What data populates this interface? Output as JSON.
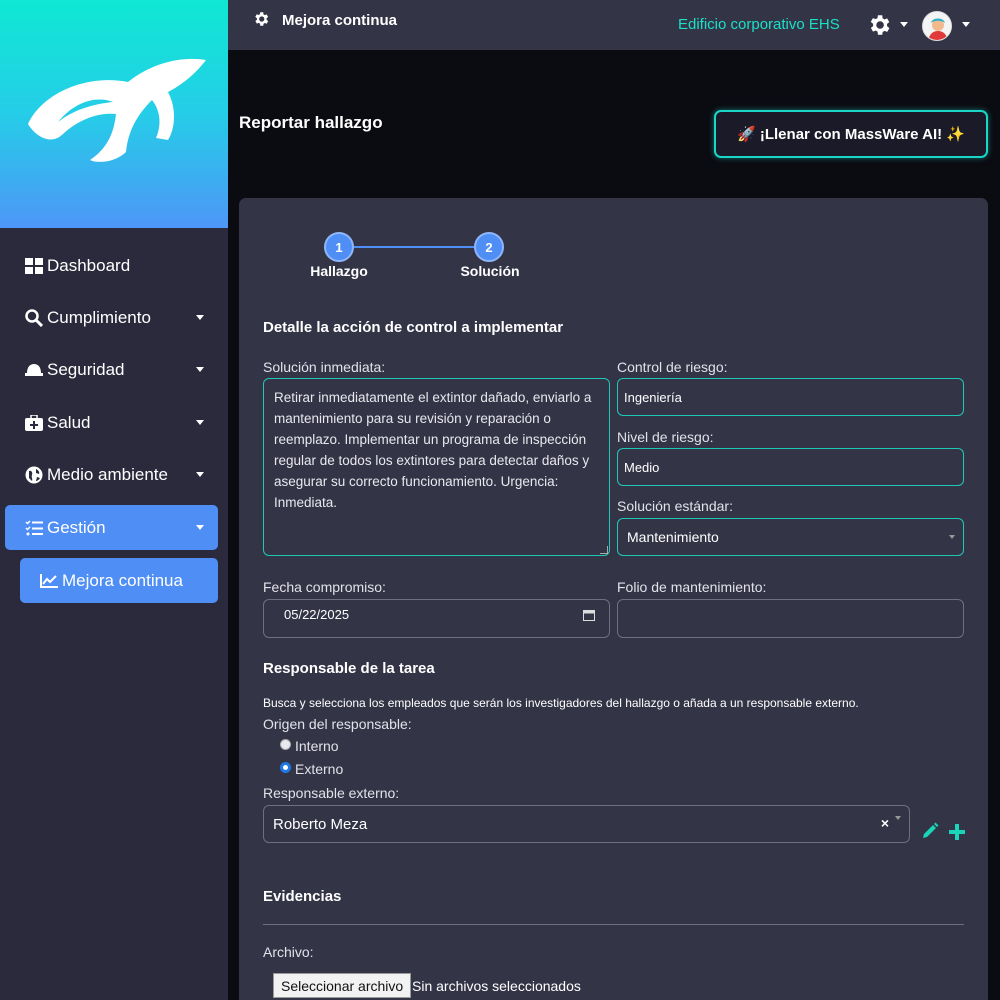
{
  "colors": {
    "accent": "#4f8ef5",
    "teal": "#19e0c8",
    "sidebar": "#2a2a3c",
    "card": "#343447"
  },
  "topbar": {
    "title": "Mejora continua",
    "building": "Edificio corporativo EHS",
    "gear_icon": "gear-icon",
    "avatar": "avatar"
  },
  "sidebar": {
    "items": [
      {
        "label": "Dashboard",
        "icon": "grid-icon"
      },
      {
        "label": "Cumplimiento",
        "icon": "search-icon"
      },
      {
        "label": "Seguridad",
        "icon": "hardhat-icon"
      },
      {
        "label": "Salud",
        "icon": "medkit-icon"
      },
      {
        "label": "Medio ambiente",
        "icon": "globe-icon"
      },
      {
        "label": "Gestión",
        "icon": "tasks-icon"
      }
    ],
    "subitem": {
      "label": "Mejora continua",
      "icon": "chart-line-icon"
    }
  },
  "header": {
    "title": "Reportar hallazgo",
    "ai_button": "🚀 ¡Llenar con MassWare AI! ✨"
  },
  "stepper": {
    "steps": [
      {
        "number": "1",
        "label": "Hallazgo"
      },
      {
        "number": "2",
        "label": "Solución"
      }
    ]
  },
  "form": {
    "section_title": "Detalle la acción de control a implementar",
    "solucion_label": "Solución inmediata:",
    "solucion_value": "Retirar inmediatamente el extintor dañado, enviarlo a mantenimiento para su revisión y reparación o reemplazo. Implementar un programa de inspección regular de todos los extintores para detectar daños y asegurar su correcto funcionamiento. Urgencia: Inmediata.",
    "control_label": "Control de riesgo:",
    "control_value": "Ingeniería",
    "nivel_label": "Nivel de riesgo:",
    "nivel_value": "Medio",
    "estandar_label": "Solución estándar:",
    "estandar_value": "Mantenimiento",
    "fecha_label": "Fecha compromiso:",
    "fecha_value": "05/22/2025",
    "folio_label": "Folio de mantenimiento:",
    "folio_value": ""
  },
  "responsable": {
    "title": "Responsable de la tarea",
    "description": "Busca y selecciona los empleados que serán los investigadores del hallazgo o añada a un responsable externo.",
    "origen_label": "Origen del responsable:",
    "options": [
      "Interno",
      "Externo"
    ],
    "selected": "Externo",
    "externo_label": "Responsable externo:",
    "externo_value": "Roberto Meza",
    "clear_glyph": "×"
  },
  "evidencias": {
    "title": "Evidencias",
    "archivo_label": "Archivo:",
    "file_button": "Seleccionar archivo",
    "file_status": "Sin archivos seleccionados"
  }
}
